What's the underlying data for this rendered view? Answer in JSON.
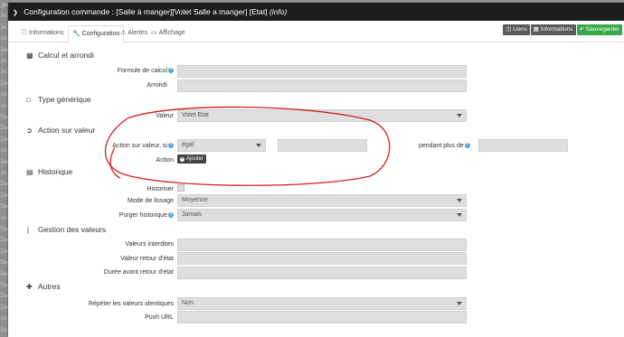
{
  "bg_sidebar_rows": [
    "ype",
    "Ac",
    "Ac",
    "Ac",
    "De",
    "Ac",
    "Ac",
    "De",
    "Ac",
    "Ac",
    "De",
    "De",
    "De",
    "Ac",
    "De",
    "Ac",
    "De",
    "De",
    "De",
    "Ac",
    "De",
    "De",
    "De",
    "De",
    "De",
    "De",
    "De",
    "De",
    "Ac",
    "De"
  ],
  "titlebar": {
    "title": "Configuration commande : [Salle à manger][Volet Salle a manger] [Etat]",
    "info": "(info)"
  },
  "tabs": [
    {
      "label": "Informations",
      "icon": "info-circle-icon"
    },
    {
      "label": "Configuration",
      "icon": "wrench-icon"
    },
    {
      "label": "Alertes",
      "icon": "warning-icon"
    },
    {
      "label": "Affichage",
      "icon": "desktop-icon"
    }
  ],
  "buttons": {
    "liens": "Liens",
    "informations": "Informations",
    "sauvegarder": "Sauvegarder"
  },
  "sections": {
    "calcul": "Calcul et arrondi",
    "type": "Type générique",
    "action": "Action sur valeur",
    "historique": "Historique",
    "gestion": "Gestion des valeurs",
    "autres": "Autres"
  },
  "calcul": {
    "formule_label": "Formule de calcul",
    "formule_value": "",
    "arrondi_label": "Arrondi",
    "arrondi_value": ""
  },
  "type": {
    "valeur_label": "Valeur",
    "valeur_value": "Volet Etat"
  },
  "action": {
    "si_label": "Action sur valeur, si",
    "operator": "égal",
    "compare_value": "",
    "pendant_label": "pendant plus de",
    "pendant_value": "",
    "action_label": "Action",
    "add_label": "Ajouter"
  },
  "historique": {
    "historiser_label": "Historiser",
    "lissage_label": "Mode de lissage",
    "lissage_value": "Moyenne",
    "purger_label": "Purger historique",
    "purger_value": "Jamais"
  },
  "gestion": {
    "interdites_label": "Valeurs interdites",
    "retour_label": "Valeur retour d'état",
    "duree_label": "Durée avant retour d'état"
  },
  "autres": {
    "repeter_label": "Répéter les valeurs identiques",
    "repeter_value": "Non",
    "push_label": "Push URL"
  },
  "colors": {
    "titlebar": "#1d1d1d",
    "save_button": "#3aa84a",
    "annotation": "#d21f1f"
  }
}
